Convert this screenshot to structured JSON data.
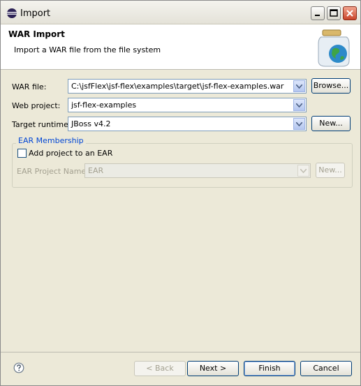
{
  "window": {
    "title": "Import"
  },
  "header": {
    "title": "WAR Import",
    "description": "Import a WAR file from the file system"
  },
  "form": {
    "war_file_label": "WAR file:",
    "war_file_value": "C:\\jsfFlex\\jsf-flex\\examples\\target\\jsf-flex-examples.war",
    "browse_label": "Browse...",
    "web_project_label": "Web project:",
    "web_project_value": "jsf-flex-examples",
    "target_runtime_label": "Target runtime:",
    "target_runtime_value": "JBoss v4.2",
    "new_runtime_label": "New..."
  },
  "ear": {
    "group_title": "EAR Membership",
    "checkbox_label": "Add project to an EAR",
    "checkbox_checked": false,
    "project_name_label": "EAR Project Name:",
    "project_name_value": "EAR",
    "new_label": "New..."
  },
  "buttons": {
    "back": "< Back",
    "next": "Next >",
    "finish": "Finish",
    "cancel": "Cancel"
  }
}
